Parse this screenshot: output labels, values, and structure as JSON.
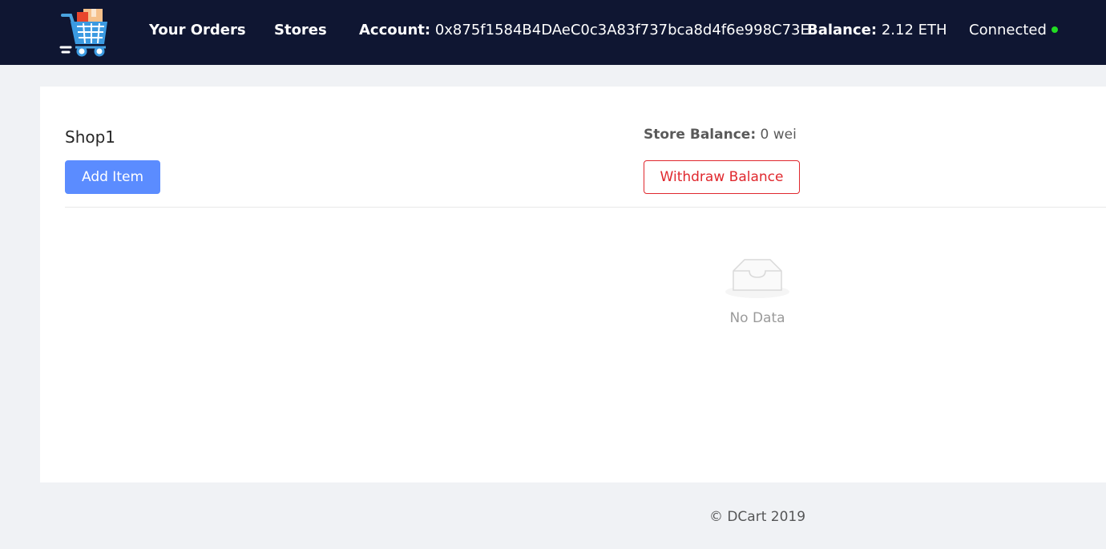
{
  "header": {
    "logo_icon": "shopping-cart-icon",
    "nav": {
      "orders": "Your Orders",
      "stores": "Stores"
    },
    "account_label": "Account:",
    "account_value": "0x875f1584B4DAeC0c3A83f737bca8d4f6e998C73E",
    "balance_label": "Balance:",
    "balance_value": "2.12 ETH",
    "status": "Connected",
    "status_color": "#22dd22",
    "background": "#0f1632"
  },
  "store": {
    "title": "Shop1",
    "add_item_label": "Add Item",
    "balance_label": "Store Balance:",
    "balance_value": "0 wei",
    "withdraw_label": "Withdraw Balance",
    "primary_color": "#5b8cff",
    "danger_color": "#e0282e"
  },
  "empty": {
    "icon": "empty-inbox-icon",
    "text": "No Data"
  },
  "footer": {
    "text": "© DCart 2019"
  }
}
